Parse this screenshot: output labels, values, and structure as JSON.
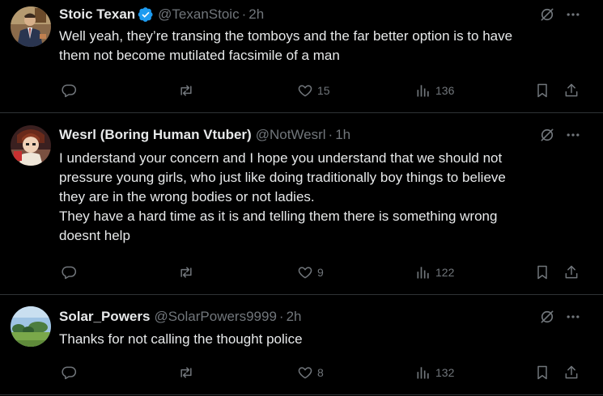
{
  "colors": {
    "background": "#000000",
    "text": "#e7e9ea",
    "muted": "#71767b",
    "verified": "#1d9bf0",
    "divider": "#2f3336"
  },
  "tweets": [
    {
      "name": "Stoic Texan",
      "verified": true,
      "handle": "@TexanStoic",
      "dot": "·",
      "time": "2h",
      "lines": [
        "Well yeah, they’re transing the tomboys and the far better option is to have",
        "them not become mutilated facsimile of a man"
      ],
      "reply_count": "",
      "repost_count": "",
      "like_count": "15",
      "view_count": "136"
    },
    {
      "name": "Wesrl (Boring Human Vtuber)",
      "verified": false,
      "handle": "@NotWesrl",
      "dot": "·",
      "time": "1h",
      "lines": [
        "I understand your concern and I hope you understand that we should not",
        "pressure young girls, who just like doing traditionally boy things to believe",
        "they are in the wrong bodies or not ladies.",
        "They have a hard time as it is and telling them there is something wrong",
        "doesnt help"
      ],
      "reply_count": "",
      "repost_count": "",
      "like_count": "9",
      "view_count": "122"
    },
    {
      "name": "Solar_Powers",
      "verified": false,
      "handle": "@SolarPowers9999",
      "dot": "·",
      "time": "2h",
      "lines": [
        "Thanks for not calling the thought police"
      ],
      "reply_count": "",
      "repost_count": "",
      "like_count": "8",
      "view_count": "132"
    }
  ]
}
